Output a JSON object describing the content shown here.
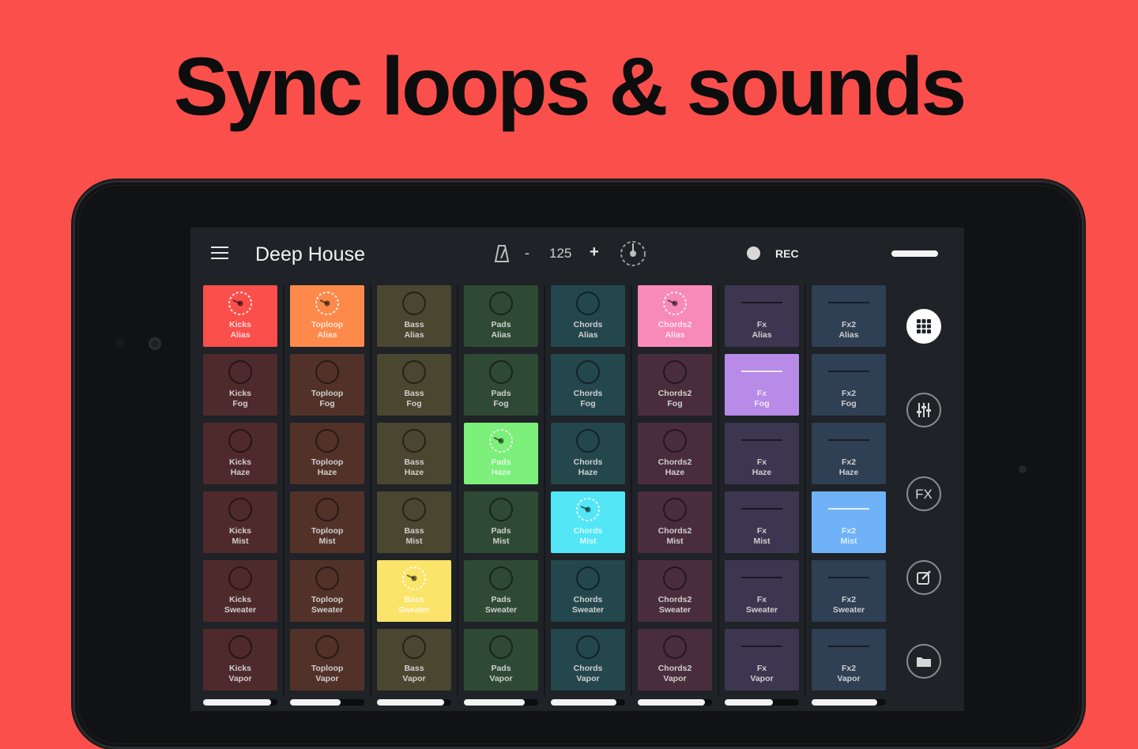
{
  "headline": "Sync loops & sounds",
  "app": {
    "title": "Deep House",
    "bpm": {
      "minus": "-",
      "value": "125",
      "plus": "+"
    },
    "rec_label": "REC"
  },
  "colors": {
    "background": "#fb4f4b",
    "screen": "#1f2226"
  },
  "columns": [
    {
      "name": "Kicks",
      "base": "#4f2a2c",
      "active_color": "#fb4f4b",
      "active_row": 0,
      "volume": 0.92,
      "pads": [
        {
          "l1": "Kicks",
          "l2": "Alias"
        },
        {
          "l1": "Kicks",
          "l2": "Fog"
        },
        {
          "l1": "Kicks",
          "l2": "Haze"
        },
        {
          "l1": "Kicks",
          "l2": "Mist"
        },
        {
          "l1": "Kicks",
          "l2": "Sweater"
        },
        {
          "l1": "Kicks",
          "l2": "Vapor"
        }
      ]
    },
    {
      "name": "Toploop",
      "base": "#523228",
      "active_color": "#fd8a4b",
      "active_row": 0,
      "volume": 0.68,
      "pads": [
        {
          "l1": "Toploop",
          "l2": "Alias"
        },
        {
          "l1": "Toploop",
          "l2": "Fog"
        },
        {
          "l1": "Toploop",
          "l2": "Haze"
        },
        {
          "l1": "Toploop",
          "l2": "Mist"
        },
        {
          "l1": "Toploop",
          "l2": "Sweater"
        },
        {
          "l1": "Toploop",
          "l2": "Vapor"
        }
      ]
    },
    {
      "name": "Bass",
      "base": "#4b4630",
      "active_color": "#fbe46a",
      "active_row": 4,
      "volume": 0.9,
      "pads": [
        {
          "l1": "Bass",
          "l2": "Alias"
        },
        {
          "l1": "Bass",
          "l2": "Fog"
        },
        {
          "l1": "Bass",
          "l2": "Haze"
        },
        {
          "l1": "Bass",
          "l2": "Mist"
        },
        {
          "l1": "Bass",
          "l2": "Sweater"
        },
        {
          "l1": "Bass",
          "l2": "Vapor"
        }
      ]
    },
    {
      "name": "Pads",
      "base": "#2f4a34",
      "active_color": "#7cf07a",
      "active_row": 2,
      "volume": 0.82,
      "pads": [
        {
          "l1": "Pads",
          "l2": "Alias"
        },
        {
          "l1": "Pads",
          "l2": "Fog"
        },
        {
          "l1": "Pads",
          "l2": "Haze"
        },
        {
          "l1": "Pads",
          "l2": "Mist"
        },
        {
          "l1": "Pads",
          "l2": "Sweater"
        },
        {
          "l1": "Pads",
          "l2": "Vapor"
        }
      ]
    },
    {
      "name": "Chords",
      "base": "#23474d",
      "active_color": "#52e6f7",
      "active_row": 3,
      "volume": 0.88,
      "pads": [
        {
          "l1": "Chords",
          "l2": "Alias"
        },
        {
          "l1": "Chords",
          "l2": "Fog"
        },
        {
          "l1": "Chords",
          "l2": "Haze"
        },
        {
          "l1": "Chords",
          "l2": "Mist"
        },
        {
          "l1": "Chords",
          "l2": "Sweater"
        },
        {
          "l1": "Chords",
          "l2": "Vapor"
        }
      ]
    },
    {
      "name": "Chords2",
      "base": "#4a2d3c",
      "active_color": "#f88ab9",
      "active_row": 0,
      "volume": 0.9,
      "pads": [
        {
          "l1": "Chords2",
          "l2": "Alias"
        },
        {
          "l1": "Chords2",
          "l2": "Fog"
        },
        {
          "l1": "Chords2",
          "l2": "Haze"
        },
        {
          "l1": "Chords2",
          "l2": "Mist"
        },
        {
          "l1": "Chords2",
          "l2": "Sweater"
        },
        {
          "l1": "Chords2",
          "l2": "Vapor"
        }
      ]
    },
    {
      "name": "Fx",
      "base": "#3d3650",
      "active_color": "#b78be7",
      "active_row": 1,
      "volume": 0.65,
      "fx": true,
      "pads": [
        {
          "l1": "Fx",
          "l2": "Alias"
        },
        {
          "l1": "Fx",
          "l2": "Fog"
        },
        {
          "l1": "Fx",
          "l2": "Haze"
        },
        {
          "l1": "Fx",
          "l2": "Mist"
        },
        {
          "l1": "Fx",
          "l2": "Sweater"
        },
        {
          "l1": "Fx",
          "l2": "Vapor"
        }
      ]
    },
    {
      "name": "Fx2",
      "base": "#2f3f54",
      "active_color": "#6fb2f7",
      "active_row": 3,
      "volume": 0.88,
      "fx": true,
      "pads": [
        {
          "l1": "Fx2",
          "l2": "Alias"
        },
        {
          "l1": "Fx2",
          "l2": "Fog"
        },
        {
          "l1": "Fx2",
          "l2": "Haze"
        },
        {
          "l1": "Fx2",
          "l2": "Mist"
        },
        {
          "l1": "Fx2",
          "l2": "Sweater"
        },
        {
          "l1": "Fx2",
          "l2": "Vapor"
        }
      ]
    }
  ],
  "side_buttons": [
    {
      "name": "grid-view-button",
      "icon": "grid-icon",
      "active": true
    },
    {
      "name": "mixer-button",
      "icon": "sliders-icon",
      "active": false
    },
    {
      "name": "fx-button",
      "icon": "fx-icon",
      "label": "FX",
      "active": false
    },
    {
      "name": "edit-button",
      "icon": "edit-icon",
      "active": false
    },
    {
      "name": "folder-button",
      "icon": "folder-icon",
      "active": false
    }
  ]
}
